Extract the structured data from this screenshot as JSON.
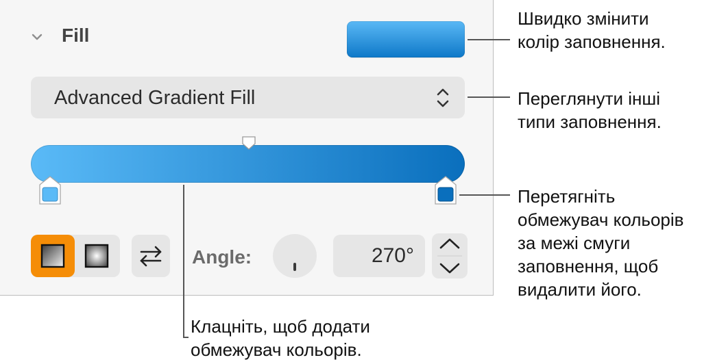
{
  "fill_panel": {
    "title": "Fill",
    "fill_type": "Advanced Gradient Fill",
    "angle_label": "Angle:",
    "angle_value": "270°",
    "gradient": {
      "start_color": "#5abaf7",
      "end_color": "#0a6fbd"
    },
    "swatch_color": "#1f8bdc",
    "active_toggle_color": "#f58d07"
  },
  "callouts": {
    "change_color": [
      "Швидко змінити",
      "колір заповнення."
    ],
    "fill_types": [
      "Переглянути інші",
      "типи заповнення."
    ],
    "drag_stop": [
      "Перетягніть",
      "обмежувач кольорів",
      "за межі смуги",
      "заповнення, щоб",
      "видалити його."
    ],
    "add_stop": [
      "Клацніть, щоб додати",
      "обмежувач кольорів."
    ]
  }
}
